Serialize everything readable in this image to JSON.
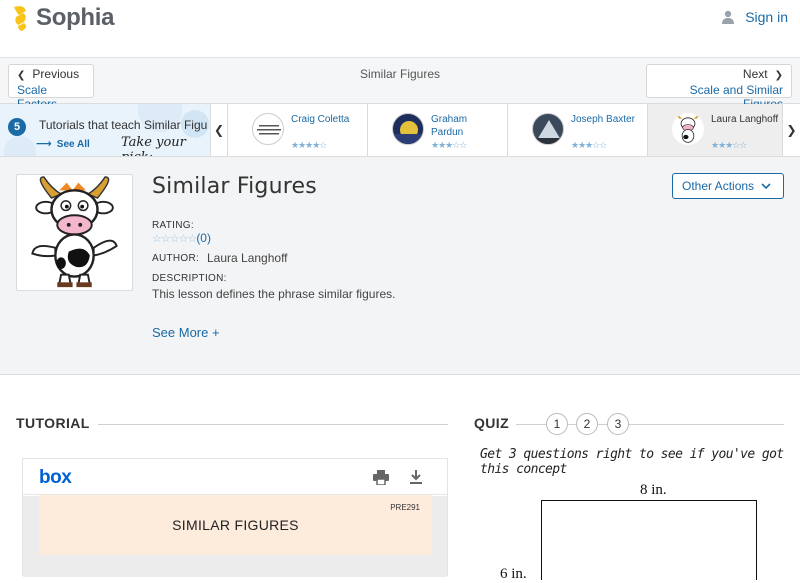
{
  "brand": {
    "name": "Sophia",
    "color": "#f9c41a"
  },
  "header": {
    "signin_label": "Sign in",
    "user_icon": "user-icon"
  },
  "nav": {
    "prev_label": "Previous",
    "prev_target": "Scale Factors",
    "title": "Similar Figures",
    "next_label": "Next",
    "next_target": "Scale and Similar Figures"
  },
  "tutorials": {
    "count": "5",
    "title": "Tutorials that teach Similar Figu",
    "see_all": "See All",
    "take_pick": "Take your pick:",
    "teachers": [
      {
        "name": "Craig Coletta",
        "rating": 4
      },
      {
        "name": "Graham Pardun",
        "rating": 3
      },
      {
        "name": "Joseph Baxter",
        "rating": 3
      },
      {
        "name": "Laura Langhoff",
        "rating": 3
      }
    ]
  },
  "lesson": {
    "title": "Similar Figures",
    "other_actions": "Other Actions",
    "rating_label": "RATING:",
    "rating_value": "(0)",
    "author_label": "AUTHOR:",
    "author": "Laura Langhoff",
    "description_label": "DESCRIPTION:",
    "description": "This lesson defines the phrase similar figures.",
    "see_more": "See More +"
  },
  "tutorial_section": {
    "heading": "TUTORIAL",
    "viewer_brand": "box",
    "doc_code": "PRE291",
    "doc_title": "SIMILAR FIGURES"
  },
  "quiz": {
    "heading": "QUIZ",
    "steps": [
      "1",
      "2",
      "3"
    ],
    "note": "Get 3 questions right to see if you've got this concept",
    "fig_top": "8 in.",
    "fig_left": "6 in."
  },
  "colors": {
    "accent": "#1a6aa6",
    "box_blue": "#0061d5"
  }
}
